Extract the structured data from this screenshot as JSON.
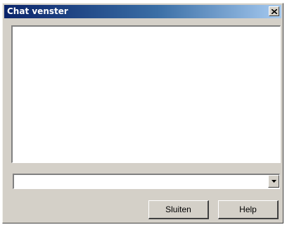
{
  "window": {
    "title": "Chat venster",
    "close_icon": "close-icon"
  },
  "chat": {
    "message_area_text": ""
  },
  "input": {
    "value": "",
    "dropdown_icon": "chevron-down-icon"
  },
  "buttons": {
    "close_label": "Sluiten",
    "help_label": "Help"
  },
  "colors": {
    "face": "#d4d0c8",
    "title_start": "#0a246a",
    "title_end": "#a6caf0",
    "field": "#ffffff"
  }
}
